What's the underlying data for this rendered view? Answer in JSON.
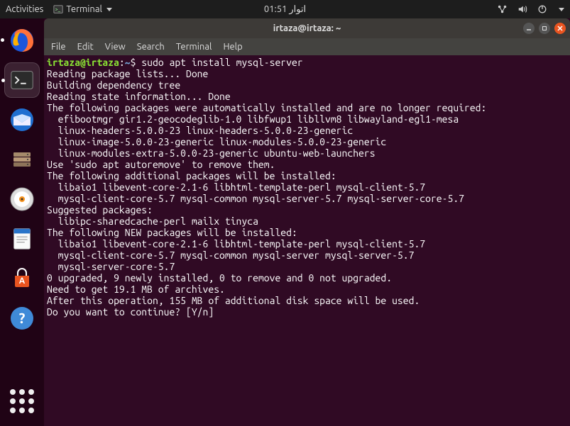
{
  "topbar": {
    "activities": "Activities",
    "appmenu": "Terminal",
    "clock": "اتوار 01:51"
  },
  "launcher": {
    "items": [
      {
        "name": "firefox"
      },
      {
        "name": "terminal"
      },
      {
        "name": "thunderbird"
      },
      {
        "name": "files"
      },
      {
        "name": "rhythmbox"
      },
      {
        "name": "writer"
      },
      {
        "name": "software"
      },
      {
        "name": "help"
      }
    ]
  },
  "window": {
    "title": "irtaza@irtaza: ~",
    "menu": [
      "File",
      "Edit",
      "View",
      "Search",
      "Terminal",
      "Help"
    ]
  },
  "prompt": {
    "user": "irtaza@irtaza",
    "colon": ":",
    "path": "~",
    "symbol": "$",
    "command": "sudo apt install mysql-server"
  },
  "output": [
    "Reading package lists... Done",
    "Building dependency tree",
    "Reading state information... Done",
    "The following packages were automatically installed and are no longer required:",
    "  efibootmgr gir1.2-geocodeglib-1.0 libfwup1 libllvm8 libwayland-egl1-mesa",
    "  linux-headers-5.0.0-23 linux-headers-5.0.0-23-generic",
    "  linux-image-5.0.0-23-generic linux-modules-5.0.0-23-generic",
    "  linux-modules-extra-5.0.0-23-generic ubuntu-web-launchers",
    "Use 'sudo apt autoremove' to remove them.",
    "The following additional packages will be installed:",
    "  libaio1 libevent-core-2.1-6 libhtml-template-perl mysql-client-5.7",
    "  mysql-client-core-5.7 mysql-common mysql-server-5.7 mysql-server-core-5.7",
    "Suggested packages:",
    "  libipc-sharedcache-perl mailx tinyca",
    "The following NEW packages will be installed:",
    "  libaio1 libevent-core-2.1-6 libhtml-template-perl mysql-client-5.7",
    "  mysql-client-core-5.7 mysql-common mysql-server mysql-server-5.7",
    "  mysql-server-core-5.7",
    "0 upgraded, 9 newly installed, 0 to remove and 0 not upgraded.",
    "Need to get 19.1 MB of archives.",
    "After this operation, 155 MB of additional disk space will be used.",
    "Do you want to continue? [Y/n]"
  ]
}
